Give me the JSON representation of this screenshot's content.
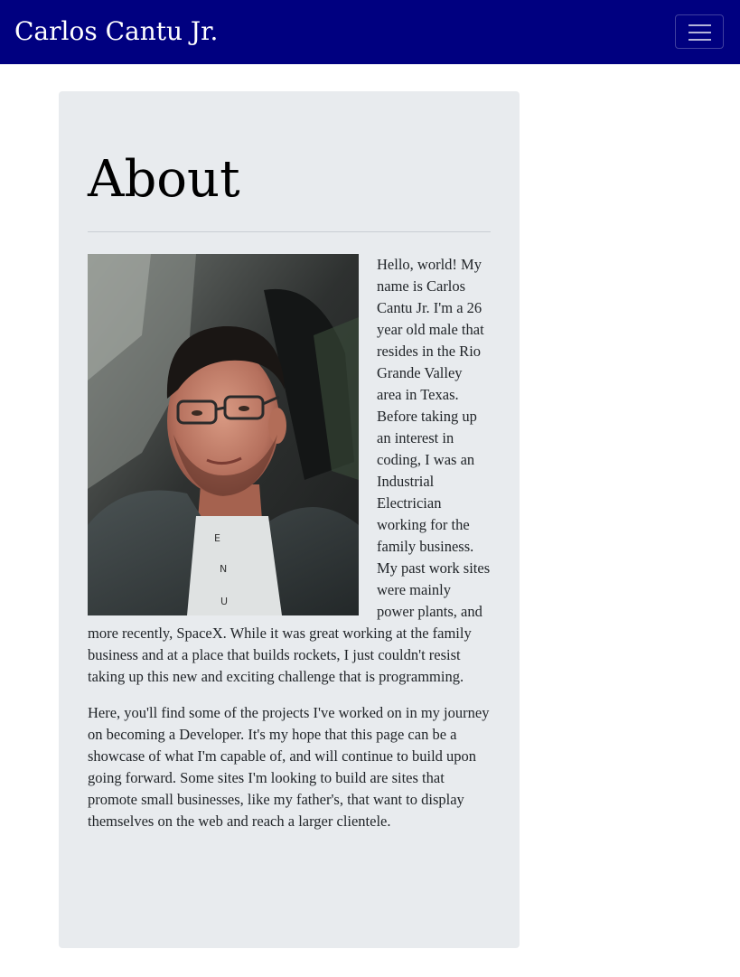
{
  "navbar": {
    "brand": "Carlos Cantu Jr.",
    "toggler_icon": "hamburger-menu-icon",
    "background": "#000080"
  },
  "about": {
    "title": "About",
    "photo_icon": "profile-photo",
    "paragraph_1": "Hello, world! My name is Carlos Cantu Jr. I'm a 26 year old male that resides in the Rio Grande Valley area in Texas. Before taking up an interest in coding, I was an Industrial Electrician working for the family business. My past work sites were mainly power plants, and more recently, SpaceX. While it was great working at the family business and at a place that builds rockets, I just couldn't resist taking up this new and exciting challenge that is programming.",
    "paragraph_2": "Here, you'll find some of the projects I've worked on in my journey on becoming a Developer. It's my hope that this page can be a showcase of what I'm capable of, and will continue to build upon going forward. Some sites I'm looking to build are sites that promote small businesses, like my father's, that want to display themselves on the web and reach a larger clientele."
  }
}
